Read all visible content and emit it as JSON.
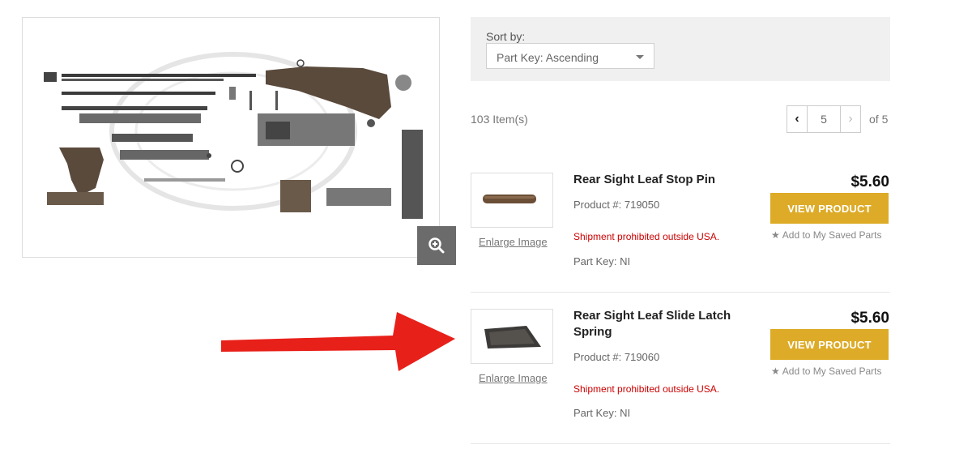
{
  "sort": {
    "label": "Sort by:",
    "selected": "Part Key: Ascending"
  },
  "listing": {
    "items_count": "103 Item(s)",
    "current_page": "5",
    "of_pages": "of 5"
  },
  "products": [
    {
      "title": "Rear Sight Leaf Stop Pin",
      "product_number": "Product #: 719050",
      "price": "$5.60",
      "button": "VIEW PRODUCT",
      "save": "Add to My Saved Parts",
      "enlarge": "Enlarge Image",
      "shipping": "Shipment prohibited outside USA.",
      "part_key": "Part Key: NI"
    },
    {
      "title": "Rear Sight Leaf Slide Latch Spring",
      "product_number": "Product #: 719060",
      "price": "$5.60",
      "button": "VIEW PRODUCT",
      "save": "Add to My Saved Parts",
      "enlarge": "Enlarge Image",
      "shipping": "Shipment prohibited outside USA.",
      "part_key": "Part Key: NI"
    }
  ],
  "colors": {
    "button_gold": "#ddab28",
    "warning_red": "#cc0000",
    "arrow_red": "#e8201a"
  },
  "icons": {
    "zoom": "zoom-in-icon",
    "star": "star-icon",
    "prev": "chevron-left-icon",
    "next": "chevron-right-icon",
    "sort_caret": "caret-down-icon"
  }
}
